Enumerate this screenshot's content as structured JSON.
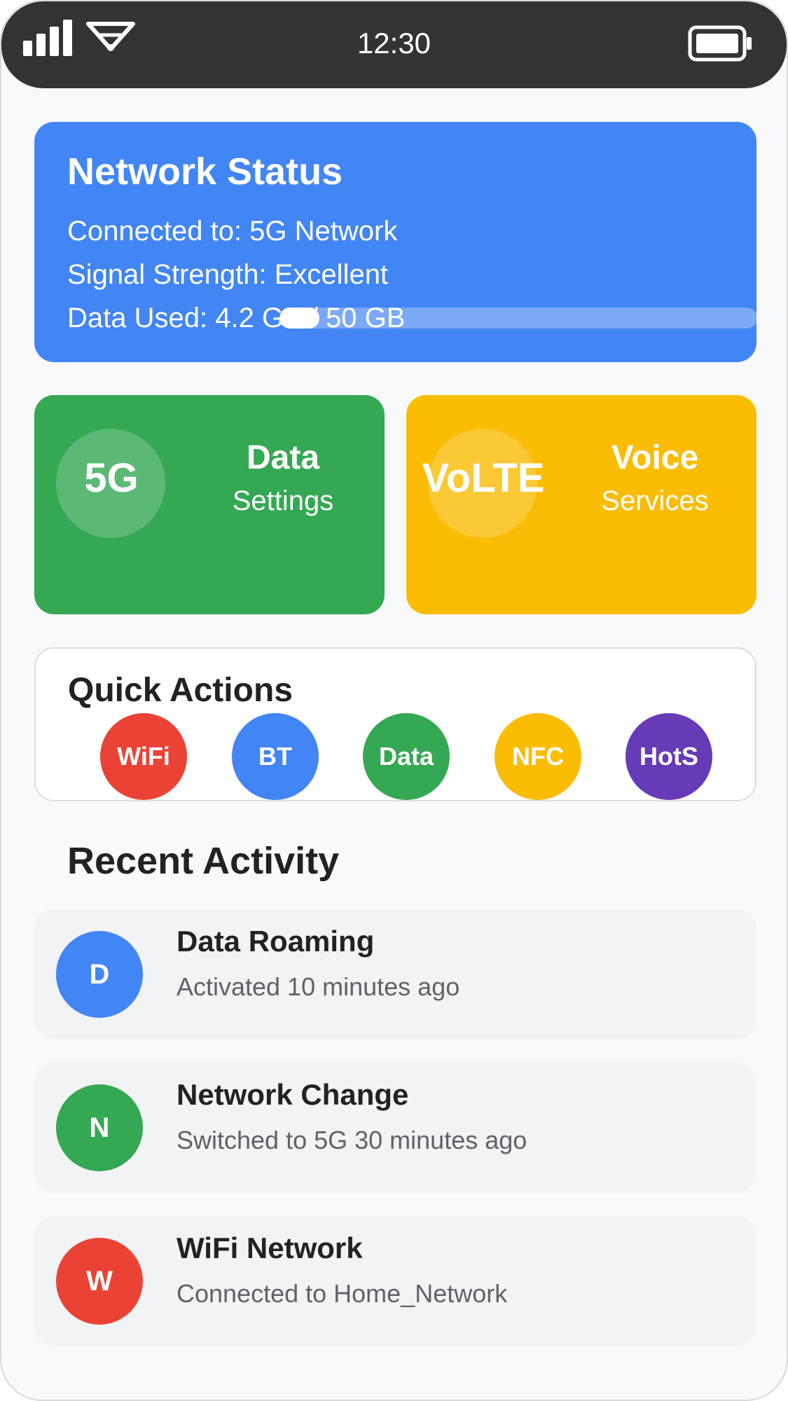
{
  "status_bar": {
    "time": "12:30",
    "icons": [
      "signal-bars-icon",
      "wifi-icon",
      "battery-icon"
    ]
  },
  "network_status": {
    "title": "Network Status",
    "connected": "Connected to: 5G Network",
    "signal": "Signal Strength: Excellent",
    "data_used": "Data Used: 4.2 GB / 50 GB",
    "usage_fraction": 0.084,
    "color": "#4285f4"
  },
  "tiles": [
    {
      "badge": "5G",
      "title": "Data",
      "subtitle": "Settings",
      "color": "#34a853"
    },
    {
      "badge": "VoLTE",
      "title": "Voice",
      "subtitle": "Services",
      "color": "#fbbc04"
    }
  ],
  "quick_actions": {
    "title": "Quick Actions",
    "buttons": [
      {
        "label": "WiFi",
        "color": "#ea4335"
      },
      {
        "label": "BT",
        "color": "#4285f4"
      },
      {
        "label": "Data",
        "color": "#34a853"
      },
      {
        "label": "NFC",
        "color": "#fbbc04"
      },
      {
        "label": "HotS",
        "color": "#673ab7"
      }
    ]
  },
  "recent_activity": {
    "title": "Recent Activity",
    "items": [
      {
        "initial": "D",
        "title": "Data Roaming",
        "description": "Activated 10 minutes ago",
        "color": "#4285f4"
      },
      {
        "initial": "N",
        "title": "Network Change",
        "description": "Switched to 5G 30 minutes ago",
        "color": "#34a853"
      },
      {
        "initial": "W",
        "title": "WiFi Network",
        "description": "Connected to Home_Network",
        "color": "#ea4335"
      }
    ]
  }
}
